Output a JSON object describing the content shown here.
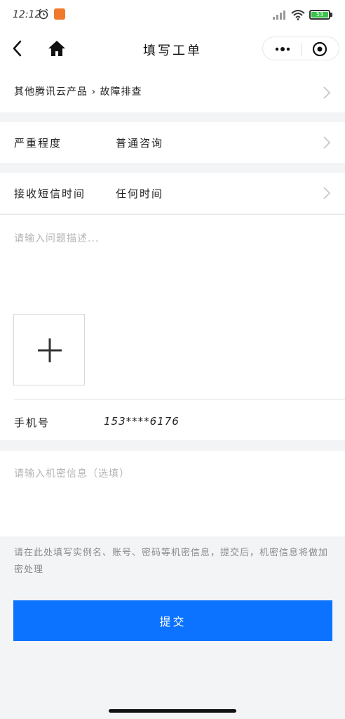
{
  "status_bar": {
    "time": "12:12",
    "battery": "53"
  },
  "nav": {
    "title": "填写工单"
  },
  "form": {
    "product_path": "其他腾讯云产品 › 故障排查",
    "severity_label": "严重程度",
    "severity_value": "普通咨询",
    "sms_label": "接收短信时间",
    "sms_value": "任何时间",
    "description_placeholder": "请输入问题描述...",
    "phone_label": "手机号",
    "phone_value": "153****6176",
    "secret_placeholder": "请输入机密信息（选填）",
    "hint": "请在此处填写实例名、账号、密码等机密信息，提交后，机密信息将做加密处理",
    "submit_label": "提交"
  },
  "colors": {
    "accent": "#0b73ff",
    "background": "#f3f4f6"
  }
}
